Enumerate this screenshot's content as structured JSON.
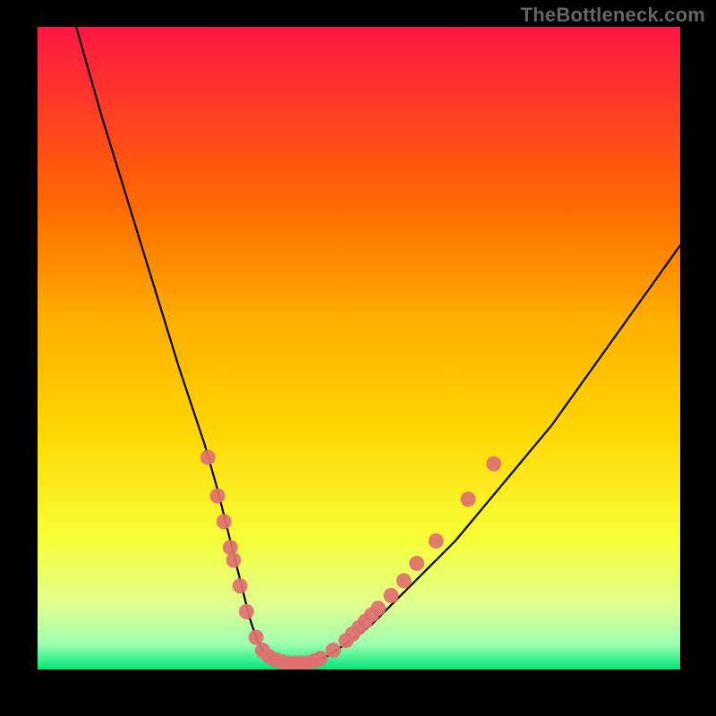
{
  "watermark": "TheBottleneck.com",
  "colors": {
    "background": "#000000",
    "watermark": "#666666",
    "curve": "#000000",
    "marker_fill": "#e07070",
    "marker_stroke": "#e07070",
    "gradient_top": "#ff1744",
    "gradient_mid_upper": "#ff8a00",
    "gradient_mid": "#ffd400",
    "gradient_lower": "#f7ff3a",
    "gradient_pale": "#f0ffa0",
    "gradient_green": "#00e676"
  },
  "chart_data": {
    "type": "line",
    "title": "",
    "xlabel": "",
    "ylabel": "",
    "xlim": [
      0,
      100
    ],
    "ylim": [
      0,
      100
    ],
    "grid": false,
    "legend": false,
    "note": "Axis values estimated from visual proportions; chart has no visible tick labels.",
    "series": [
      {
        "name": "curve",
        "x": [
          6,
          10,
          14,
          18,
          22,
          24,
          26,
          28,
          30,
          31,
          32,
          33,
          34,
          35,
          36,
          37,
          38,
          40,
          42,
          45,
          48,
          52,
          56,
          60,
          65,
          70,
          75,
          80,
          85,
          90,
          95,
          100
        ],
        "y": [
          100,
          86,
          73,
          60,
          47,
          41,
          35,
          28,
          20,
          16,
          12,
          8,
          5,
          3,
          2,
          1.5,
          1.2,
          1,
          1,
          2,
          4,
          7,
          11,
          15,
          20,
          26,
          32,
          38,
          45,
          52,
          59,
          66
        ]
      }
    ],
    "markers": [
      {
        "x": 26.5,
        "y": 33
      },
      {
        "x": 28,
        "y": 27
      },
      {
        "x": 29,
        "y": 23
      },
      {
        "x": 30,
        "y": 19
      },
      {
        "x": 30.5,
        "y": 17
      },
      {
        "x": 31.5,
        "y": 13
      },
      {
        "x": 32.5,
        "y": 9
      },
      {
        "x": 34,
        "y": 5
      },
      {
        "x": 35,
        "y": 3
      },
      {
        "x": 36,
        "y": 2
      },
      {
        "x": 37,
        "y": 1.5
      },
      {
        "x": 38,
        "y": 1.2
      },
      {
        "x": 39,
        "y": 1
      },
      {
        "x": 40,
        "y": 1
      },
      {
        "x": 41,
        "y": 1
      },
      {
        "x": 42,
        "y": 1
      },
      {
        "x": 43,
        "y": 1.3
      },
      {
        "x": 44,
        "y": 1.7
      },
      {
        "x": 46,
        "y": 3
      },
      {
        "x": 48,
        "y": 4.5
      },
      {
        "x": 49,
        "y": 5.5
      },
      {
        "x": 50,
        "y": 6.5
      },
      {
        "x": 51,
        "y": 7.5
      },
      {
        "x": 52,
        "y": 8.5
      },
      {
        "x": 53,
        "y": 9.5
      },
      {
        "x": 55,
        "y": 11.5
      },
      {
        "x": 57,
        "y": 13.8
      },
      {
        "x": 59,
        "y": 16.5
      },
      {
        "x": 62,
        "y": 20
      },
      {
        "x": 67,
        "y": 26.5
      },
      {
        "x": 71,
        "y": 32
      }
    ]
  }
}
